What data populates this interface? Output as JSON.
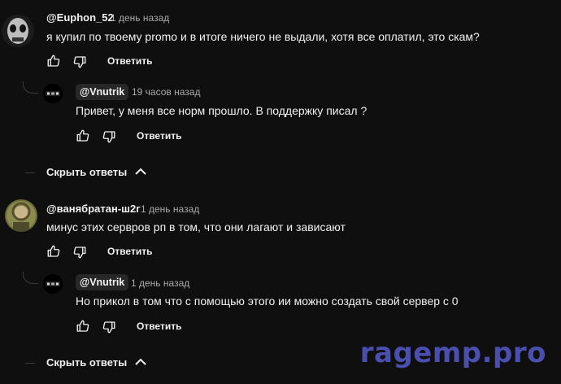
{
  "threads": [
    {
      "comment": {
        "author": "@Euphon_52",
        "time": "1 день назад",
        "text": "я купил по твоему promo и в итоге ничего не выдали, хотя все оплатил, это скам?",
        "reply_label": "Ответить"
      },
      "reply": {
        "author": "@Vnutrik",
        "time": "19 часов назад",
        "text": "Привет, у меня все норм прошло. В поддержку писал ?",
        "reply_label": "Ответить"
      },
      "hide_label": "Скрыть ответы"
    },
    {
      "comment": {
        "author": "@ванябратан-ш2г",
        "time": "1 день назад",
        "text": "минус этих сервров рп в том, что они лагают и зависают",
        "reply_label": "Ответить"
      },
      "reply": {
        "author": "@Vnutrik",
        "time": "1 день назад",
        "text": "Но прикол в том что с помощью этого ии можно создать свой сервер с 0",
        "reply_label": "Ответить"
      },
      "hide_label": "Скрыть ответы"
    }
  ],
  "watermark": "ragemp.pro",
  "colors": {
    "background": "#0f0f0f",
    "text": "#f1f1f1",
    "muted": "#aaaaaa",
    "watermark": "#4e52b8"
  },
  "icons": [
    "like-icon",
    "dislike-icon",
    "chevron-up-icon"
  ]
}
